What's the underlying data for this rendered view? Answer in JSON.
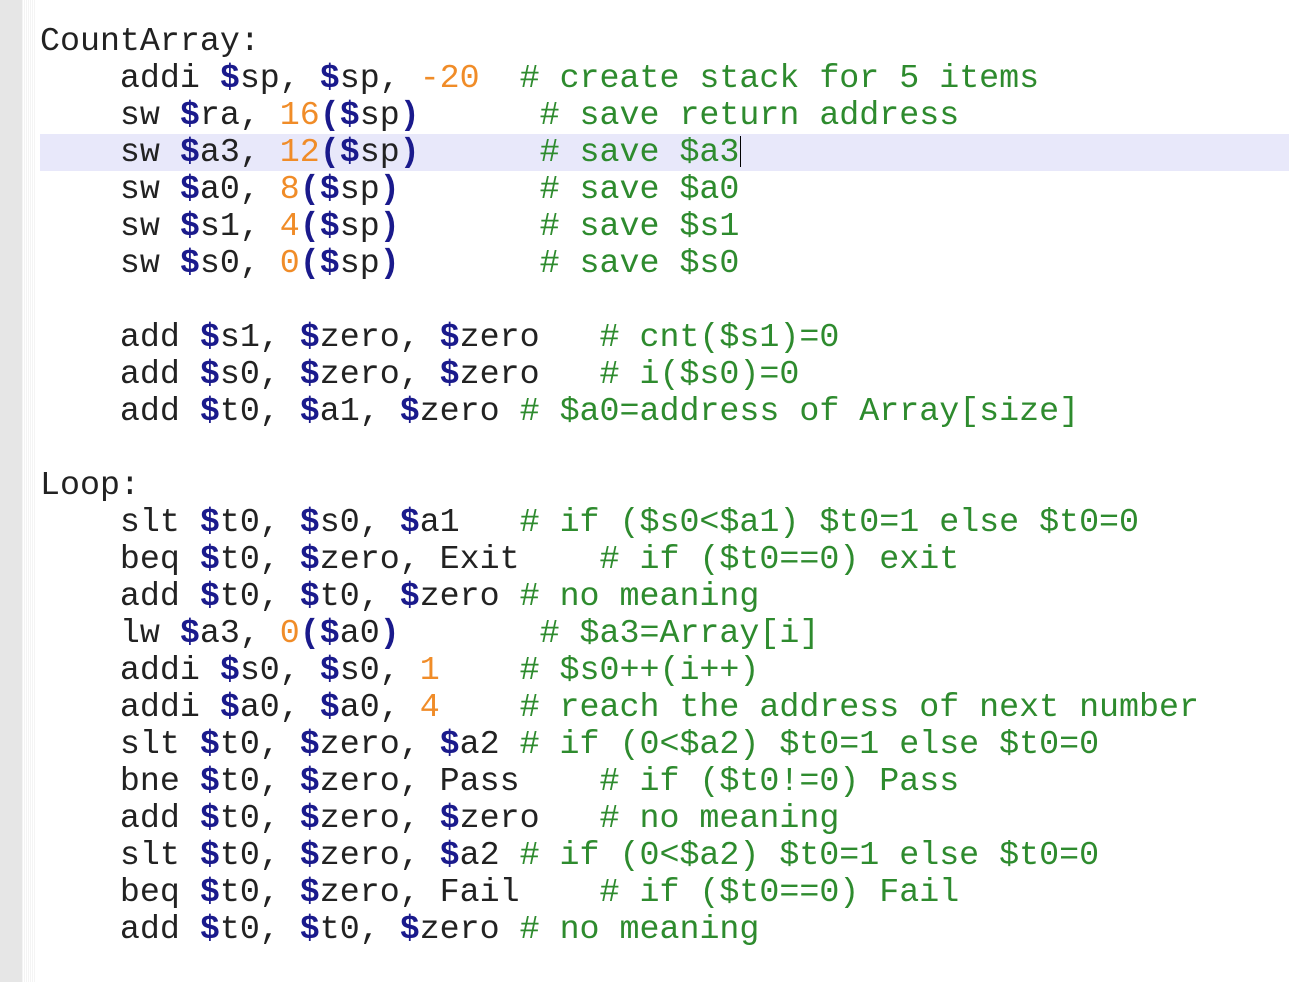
{
  "editor": {
    "current_line_index": 3,
    "lines": [
      [
        {
          "t": "CountArray:",
          "c": "plain"
        }
      ],
      [
        {
          "t": "    addi ",
          "c": "plain"
        },
        {
          "t": "$",
          "c": "dollar"
        },
        {
          "t": "sp, ",
          "c": "plain"
        },
        {
          "t": "$",
          "c": "dollar"
        },
        {
          "t": "sp, ",
          "c": "plain"
        },
        {
          "t": "-20",
          "c": "num"
        },
        {
          "t": "  # create stack for 5 items",
          "c": "comment"
        }
      ],
      [
        {
          "t": "    sw ",
          "c": "plain"
        },
        {
          "t": "$",
          "c": "dollar"
        },
        {
          "t": "ra, ",
          "c": "plain"
        },
        {
          "t": "16",
          "c": "num"
        },
        {
          "t": "(",
          "c": "paren"
        },
        {
          "t": "$",
          "c": "dollar"
        },
        {
          "t": "sp",
          "c": "plain"
        },
        {
          "t": ")",
          "c": "paren"
        },
        {
          "t": "      # save return address",
          "c": "comment"
        }
      ],
      [
        {
          "t": "    sw ",
          "c": "plain"
        },
        {
          "t": "$",
          "c": "dollar"
        },
        {
          "t": "a3, ",
          "c": "plain"
        },
        {
          "t": "12",
          "c": "num"
        },
        {
          "t": "(",
          "c": "paren"
        },
        {
          "t": "$",
          "c": "dollar"
        },
        {
          "t": "sp",
          "c": "plain"
        },
        {
          "t": ")",
          "c": "paren"
        },
        {
          "t": "      # save $a3",
          "c": "comment"
        }
      ],
      [
        {
          "t": "    sw ",
          "c": "plain"
        },
        {
          "t": "$",
          "c": "dollar"
        },
        {
          "t": "a0, ",
          "c": "plain"
        },
        {
          "t": "8",
          "c": "num"
        },
        {
          "t": "(",
          "c": "paren"
        },
        {
          "t": "$",
          "c": "dollar"
        },
        {
          "t": "sp",
          "c": "plain"
        },
        {
          "t": ")",
          "c": "paren"
        },
        {
          "t": "       # save $a0",
          "c": "comment"
        }
      ],
      [
        {
          "t": "    sw ",
          "c": "plain"
        },
        {
          "t": "$",
          "c": "dollar"
        },
        {
          "t": "s1, ",
          "c": "plain"
        },
        {
          "t": "4",
          "c": "num"
        },
        {
          "t": "(",
          "c": "paren"
        },
        {
          "t": "$",
          "c": "dollar"
        },
        {
          "t": "sp",
          "c": "plain"
        },
        {
          "t": ")",
          "c": "paren"
        },
        {
          "t": "       # save $s1",
          "c": "comment"
        }
      ],
      [
        {
          "t": "    sw ",
          "c": "plain"
        },
        {
          "t": "$",
          "c": "dollar"
        },
        {
          "t": "s0, ",
          "c": "plain"
        },
        {
          "t": "0",
          "c": "num"
        },
        {
          "t": "(",
          "c": "paren"
        },
        {
          "t": "$",
          "c": "dollar"
        },
        {
          "t": "sp",
          "c": "plain"
        },
        {
          "t": ")",
          "c": "paren"
        },
        {
          "t": "       # save $s0",
          "c": "comment"
        }
      ],
      [
        {
          "t": "",
          "c": "plain"
        }
      ],
      [
        {
          "t": "    add ",
          "c": "plain"
        },
        {
          "t": "$",
          "c": "dollar"
        },
        {
          "t": "s1, ",
          "c": "plain"
        },
        {
          "t": "$",
          "c": "dollar"
        },
        {
          "t": "zero, ",
          "c": "plain"
        },
        {
          "t": "$",
          "c": "dollar"
        },
        {
          "t": "zero",
          "c": "plain"
        },
        {
          "t": "   # cnt($s1)=0",
          "c": "comment"
        }
      ],
      [
        {
          "t": "    add ",
          "c": "plain"
        },
        {
          "t": "$",
          "c": "dollar"
        },
        {
          "t": "s0, ",
          "c": "plain"
        },
        {
          "t": "$",
          "c": "dollar"
        },
        {
          "t": "zero, ",
          "c": "plain"
        },
        {
          "t": "$",
          "c": "dollar"
        },
        {
          "t": "zero",
          "c": "plain"
        },
        {
          "t": "   # i($s0)=0",
          "c": "comment"
        }
      ],
      [
        {
          "t": "    add ",
          "c": "plain"
        },
        {
          "t": "$",
          "c": "dollar"
        },
        {
          "t": "t0, ",
          "c": "plain"
        },
        {
          "t": "$",
          "c": "dollar"
        },
        {
          "t": "a1, ",
          "c": "plain"
        },
        {
          "t": "$",
          "c": "dollar"
        },
        {
          "t": "zero",
          "c": "plain"
        },
        {
          "t": " # $a0=address of Array[size]",
          "c": "comment"
        }
      ],
      [
        {
          "t": "",
          "c": "plain"
        }
      ],
      [
        {
          "t": "Loop:",
          "c": "plain"
        }
      ],
      [
        {
          "t": "    slt ",
          "c": "plain"
        },
        {
          "t": "$",
          "c": "dollar"
        },
        {
          "t": "t0, ",
          "c": "plain"
        },
        {
          "t": "$",
          "c": "dollar"
        },
        {
          "t": "s0, ",
          "c": "plain"
        },
        {
          "t": "$",
          "c": "dollar"
        },
        {
          "t": "a1",
          "c": "plain"
        },
        {
          "t": "   # if ($s0<$a1) $t0=1 else $t0=0",
          "c": "comment"
        }
      ],
      [
        {
          "t": "    beq ",
          "c": "plain"
        },
        {
          "t": "$",
          "c": "dollar"
        },
        {
          "t": "t0, ",
          "c": "plain"
        },
        {
          "t": "$",
          "c": "dollar"
        },
        {
          "t": "zero, Exit",
          "c": "plain"
        },
        {
          "t": "    # if ($t0==0) exit",
          "c": "comment"
        }
      ],
      [
        {
          "t": "    add ",
          "c": "plain"
        },
        {
          "t": "$",
          "c": "dollar"
        },
        {
          "t": "t0, ",
          "c": "plain"
        },
        {
          "t": "$",
          "c": "dollar"
        },
        {
          "t": "t0, ",
          "c": "plain"
        },
        {
          "t": "$",
          "c": "dollar"
        },
        {
          "t": "zero",
          "c": "plain"
        },
        {
          "t": " # no meaning",
          "c": "comment"
        }
      ],
      [
        {
          "t": "    lw ",
          "c": "plain"
        },
        {
          "t": "$",
          "c": "dollar"
        },
        {
          "t": "a3, ",
          "c": "plain"
        },
        {
          "t": "0",
          "c": "num"
        },
        {
          "t": "(",
          "c": "paren"
        },
        {
          "t": "$",
          "c": "dollar"
        },
        {
          "t": "a0",
          "c": "plain"
        },
        {
          "t": ")",
          "c": "paren"
        },
        {
          "t": "       # $a3=Array[i]",
          "c": "comment"
        }
      ],
      [
        {
          "t": "    addi ",
          "c": "plain"
        },
        {
          "t": "$",
          "c": "dollar"
        },
        {
          "t": "s0, ",
          "c": "plain"
        },
        {
          "t": "$",
          "c": "dollar"
        },
        {
          "t": "s0, ",
          "c": "plain"
        },
        {
          "t": "1",
          "c": "num"
        },
        {
          "t": "    # $s0++(i++)",
          "c": "comment"
        }
      ],
      [
        {
          "t": "    addi ",
          "c": "plain"
        },
        {
          "t": "$",
          "c": "dollar"
        },
        {
          "t": "a0, ",
          "c": "plain"
        },
        {
          "t": "$",
          "c": "dollar"
        },
        {
          "t": "a0, ",
          "c": "plain"
        },
        {
          "t": "4",
          "c": "num"
        },
        {
          "t": "    # reach the address of next number",
          "c": "comment"
        }
      ],
      [
        {
          "t": "    slt ",
          "c": "plain"
        },
        {
          "t": "$",
          "c": "dollar"
        },
        {
          "t": "t0, ",
          "c": "plain"
        },
        {
          "t": "$",
          "c": "dollar"
        },
        {
          "t": "zero, ",
          "c": "plain"
        },
        {
          "t": "$",
          "c": "dollar"
        },
        {
          "t": "a2",
          "c": "plain"
        },
        {
          "t": " # if (0<$a2) $t0=1 else $t0=0",
          "c": "comment"
        }
      ],
      [
        {
          "t": "    bne ",
          "c": "plain"
        },
        {
          "t": "$",
          "c": "dollar"
        },
        {
          "t": "t0, ",
          "c": "plain"
        },
        {
          "t": "$",
          "c": "dollar"
        },
        {
          "t": "zero, Pass",
          "c": "plain"
        },
        {
          "t": "    # if ($t0!=0) Pass",
          "c": "comment"
        }
      ],
      [
        {
          "t": "    add ",
          "c": "plain"
        },
        {
          "t": "$",
          "c": "dollar"
        },
        {
          "t": "t0, ",
          "c": "plain"
        },
        {
          "t": "$",
          "c": "dollar"
        },
        {
          "t": "zero, ",
          "c": "plain"
        },
        {
          "t": "$",
          "c": "dollar"
        },
        {
          "t": "zero",
          "c": "plain"
        },
        {
          "t": "   # no meaning",
          "c": "comment"
        }
      ],
      [
        {
          "t": "    slt ",
          "c": "plain"
        },
        {
          "t": "$",
          "c": "dollar"
        },
        {
          "t": "t0, ",
          "c": "plain"
        },
        {
          "t": "$",
          "c": "dollar"
        },
        {
          "t": "zero, ",
          "c": "plain"
        },
        {
          "t": "$",
          "c": "dollar"
        },
        {
          "t": "a2",
          "c": "plain"
        },
        {
          "t": " # if (0<$a2) $t0=1 else $t0=0",
          "c": "comment"
        }
      ],
      [
        {
          "t": "    beq ",
          "c": "plain"
        },
        {
          "t": "$",
          "c": "dollar"
        },
        {
          "t": "t0, ",
          "c": "plain"
        },
        {
          "t": "$",
          "c": "dollar"
        },
        {
          "t": "zero, Fail",
          "c": "plain"
        },
        {
          "t": "    # if ($t0==0) Fail",
          "c": "comment"
        }
      ],
      [
        {
          "t": "    add ",
          "c": "plain"
        },
        {
          "t": "$",
          "c": "dollar"
        },
        {
          "t": "t0, ",
          "c": "plain"
        },
        {
          "t": "$",
          "c": "dollar"
        },
        {
          "t": "t0, ",
          "c": "plain"
        },
        {
          "t": "$",
          "c": "dollar"
        },
        {
          "t": "zero",
          "c": "plain"
        },
        {
          "t": " # no meaning",
          "c": "comment"
        }
      ]
    ]
  },
  "colors": {
    "register_sigil": "#1a1a8c",
    "number": "#f08c28",
    "comment": "#2e8b2e",
    "current_line_highlight": "#e8e8fa"
  }
}
